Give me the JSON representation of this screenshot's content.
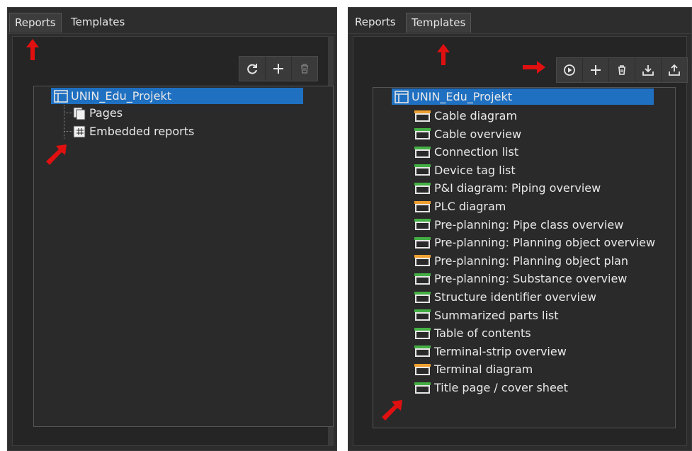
{
  "left_panel": {
    "tabs": [
      {
        "label": "Reports",
        "active": true
      },
      {
        "label": "Templates",
        "active": false
      }
    ],
    "toolbar": [
      {
        "icon": "refresh-icon",
        "enabled": true
      },
      {
        "icon": "plus-icon",
        "enabled": true
      },
      {
        "icon": "trash-icon",
        "enabled": false
      }
    ],
    "tree": {
      "root": "UNIN_Edu_Projekt",
      "children": [
        {
          "label": "Pages",
          "icon": "pages-icon"
        },
        {
          "label": "Embedded reports",
          "icon": "embedded-report-icon"
        }
      ]
    }
  },
  "right_panel": {
    "tabs": [
      {
        "label": "Reports",
        "active": false
      },
      {
        "label": "Templates",
        "active": true
      }
    ],
    "toolbar": [
      {
        "icon": "play-icon"
      },
      {
        "icon": "plus-icon"
      },
      {
        "icon": "trash-icon"
      },
      {
        "icon": "import-icon"
      },
      {
        "icon": "export-icon"
      }
    ],
    "tree": {
      "root": "UNIN_Edu_Projekt",
      "items": [
        {
          "label": "Cable diagram",
          "color": "#f0a030"
        },
        {
          "label": "Cable overview",
          "color": "#44b044"
        },
        {
          "label": "Connection list",
          "color": "#44b044"
        },
        {
          "label": "Device tag list",
          "color": "#44b044"
        },
        {
          "label": "P&I diagram: Piping overview",
          "color": "#44b044"
        },
        {
          "label": "PLC diagram",
          "color": "#f0a030"
        },
        {
          "label": "Pre-planning: Pipe class overview",
          "color": "#44b044"
        },
        {
          "label": "Pre-planning: Planning object overview",
          "color": "#44b044"
        },
        {
          "label": "Pre-planning: Planning object plan",
          "color": "#f0a030"
        },
        {
          "label": "Pre-planning: Substance overview",
          "color": "#44b044"
        },
        {
          "label": "Structure identifier overview",
          "color": "#44b044"
        },
        {
          "label": "Summarized parts list",
          "color": "#44b044"
        },
        {
          "label": "Table of contents",
          "color": "#44b044"
        },
        {
          "label": "Terminal-strip overview",
          "color": "#44b044"
        },
        {
          "label": "Terminal diagram",
          "color": "#f0a030"
        },
        {
          "label": "Title page / cover sheet",
          "color": "#44b044"
        }
      ]
    }
  },
  "colors": {
    "selection": "#1f70c1",
    "annotation_arrow": "#e01010",
    "panel_bg": "#2d2d2d"
  }
}
